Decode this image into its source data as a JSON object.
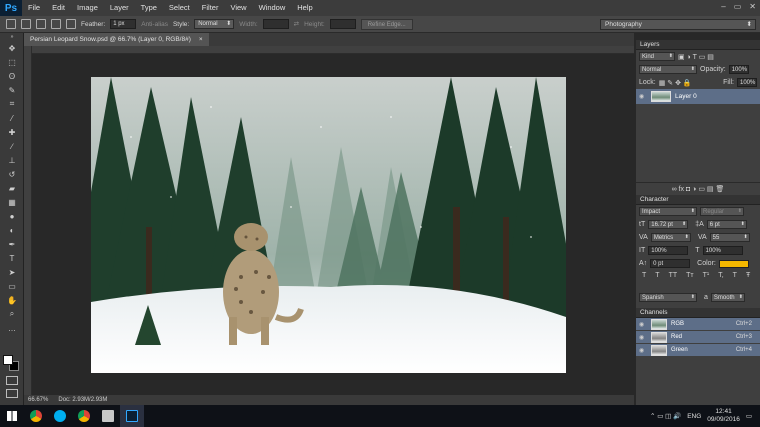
{
  "menubar": {
    "logo": "Ps",
    "items": [
      "File",
      "Edit",
      "Image",
      "Layer",
      "Type",
      "Select",
      "Filter",
      "View",
      "Window",
      "Help"
    ],
    "controls": [
      "–",
      "▭",
      "✕"
    ]
  },
  "options": {
    "feather_label": "Feather:",
    "feather_value": "1 px",
    "antialias_label": "Anti-alias",
    "style_label": "Style:",
    "style_value": "Normal",
    "width_label": "Width:",
    "height_label": "Height:",
    "refine_label": "Refine Edge...",
    "workspace": "Photography"
  },
  "document": {
    "tab_title": "Persian Leopard Snow.psd @ 66.7% (Layer 0, RGB/8#)",
    "close": "×",
    "zoom": "66.67%",
    "doc_size": "Doc: 2.93M/2.93M"
  },
  "layers": {
    "title": "Layers",
    "kind": "Kind",
    "blend_mode": "Normal",
    "opacity_label": "Opacity:",
    "opacity_value": "100%",
    "lock_label": "Lock:",
    "fill_label": "Fill:",
    "fill_value": "100%",
    "layer_name": "Layer 0",
    "bottom_icons": "∞ fx ◘ ◑ ▭ ▤ 🗑"
  },
  "character": {
    "title": "Character",
    "font_family": "Impact",
    "font_style": "Regular",
    "font_size": "16.72 pt",
    "leading": "6 pt",
    "kerning": "Metrics",
    "tracking": "55",
    "vscale": "100%",
    "hscale": "100%",
    "baseline": "0 pt",
    "color_label": "Color:",
    "color_hex": "#f5b800",
    "styles": [
      "T",
      "T",
      "TT",
      "Tт",
      "T¹",
      "T,",
      "T",
      "Ŧ"
    ],
    "language": "Spanish",
    "antialias": "Smooth",
    "aa_icon": "a"
  },
  "channels": {
    "title": "Channels",
    "rows": [
      {
        "name": "RGB",
        "shortcut": "Ctrl+2"
      },
      {
        "name": "Red",
        "shortcut": "Ctrl+3"
      },
      {
        "name": "Green",
        "shortcut": "Ctrl+4"
      }
    ]
  },
  "taskbar": {
    "lang": "ENG",
    "time": "12:41",
    "date": "09/09/2016",
    "tray_icons": "⌃ ▭ ◫ 🔊"
  }
}
